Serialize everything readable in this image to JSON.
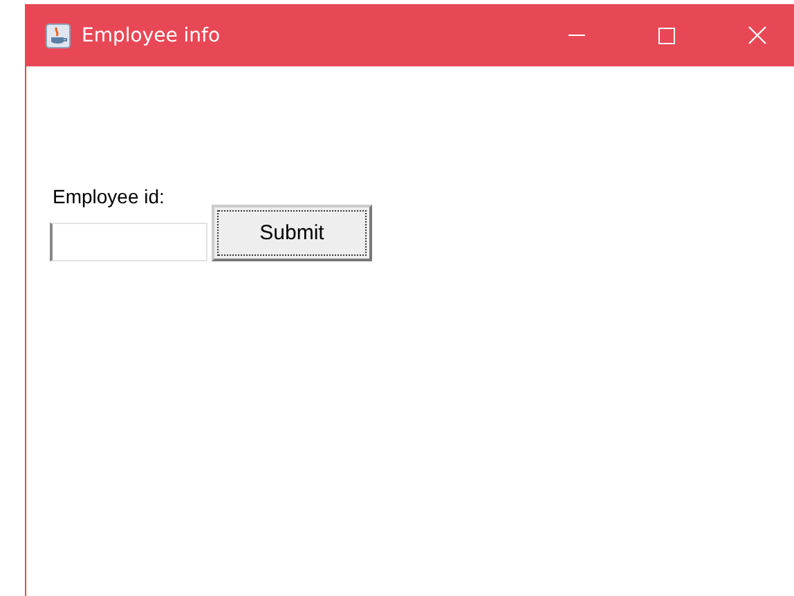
{
  "window": {
    "title": "Employee info"
  },
  "form": {
    "label": "Employee id:",
    "button": "Submit"
  }
}
